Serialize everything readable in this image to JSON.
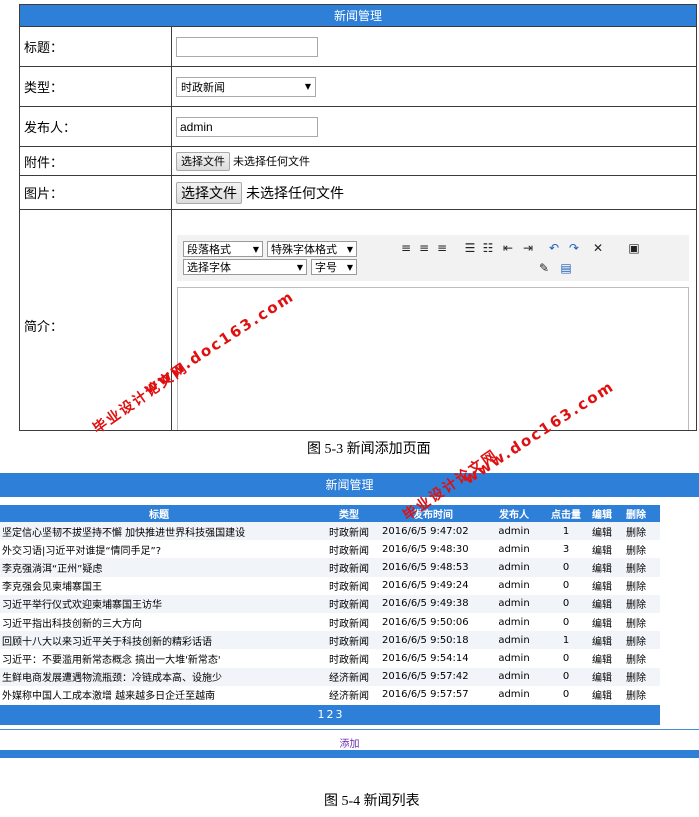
{
  "form": {
    "header": "新闻管理",
    "rows": {
      "title": {
        "label": "标题：",
        "value": ""
      },
      "type": {
        "label": "类型：",
        "selected": "时政新闻"
      },
      "publisher": {
        "label": "发布人：",
        "value": "admin"
      },
      "attachment": {
        "label": "附件：",
        "button": "选择文件",
        "status": "未选择任何文件"
      },
      "image": {
        "label": "图片：",
        "button": "选择文件",
        "status": "未选择任何文件"
      },
      "intro": {
        "label": "简介："
      }
    },
    "editor": {
      "paragraph_format": "段落格式",
      "special_font_format": "特殊字体格式",
      "font_select": "选择字体",
      "font_size": "字号",
      "icons": [
        "align-left-icon",
        "align-center-icon",
        "align-right-icon",
        "bullet-list-icon",
        "numbered-list-icon",
        "outdent-icon",
        "indent-icon",
        "undo-icon",
        "redo-icon",
        "remove-format-icon",
        "paste-icon",
        "highlight-icon",
        "image-icon"
      ]
    }
  },
  "captions": {
    "fig1": "图 5-3 新闻添加页面",
    "fig2": "图 5-4 新闻列表"
  },
  "list": {
    "header": "新闻管理",
    "columns": [
      "标题",
      "类型",
      "发布时间",
      "发布人",
      "点击量",
      "编辑",
      "删除"
    ],
    "rows": [
      [
        "坚定信心坚韧不拔坚持不懈 加快推进世界科技强国建设",
        "时政新闻",
        "2016/6/5 9:47:02",
        "admin",
        "1",
        "编辑",
        "删除"
      ],
      [
        "外交习语|习近平对谁提“情同手足”?",
        "时政新闻",
        "2016/6/5 9:48:30",
        "admin",
        "3",
        "编辑",
        "删除"
      ],
      [
        "李克强淌洱“正州”疑虑",
        "时政新闻",
        "2016/6/5 9:48:53",
        "admin",
        "0",
        "编辑",
        "删除"
      ],
      [
        "李克强会见柬埔寨国王",
        "时政新闻",
        "2016/6/5 9:49:24",
        "admin",
        "0",
        "编辑",
        "删除"
      ],
      [
        "习近平举行仪式欢迎柬埔寨国王访华",
        "时政新闻",
        "2016/6/5 9:49:38",
        "admin",
        "0",
        "编辑",
        "删除"
      ],
      [
        "习近平指出科技创新的三大方向",
        "时政新闻",
        "2016/6/5 9:50:06",
        "admin",
        "0",
        "编辑",
        "删除"
      ],
      [
        "回顾十八大以来习近平关于科技创新的精彩话语",
        "时政新闻",
        "2016/6/5 9:50:18",
        "admin",
        "1",
        "编辑",
        "删除"
      ],
      [
        "习近平：不要滥用新常态概念 搞出一大堆'新常态'",
        "时政新闻",
        "2016/6/5 9:54:14",
        "admin",
        "0",
        "编辑",
        "删除"
      ],
      [
        "生鲜电商发展遭遇物流瓶颈：冷链成本高、设施少",
        "经济新闻",
        "2016/6/5 9:57:42",
        "admin",
        "0",
        "编辑",
        "删除"
      ],
      [
        "外媒称中国人工成本激增 越来越多日企迁至越南",
        "经济新闻",
        "2016/6/5 9:57:57",
        "admin",
        "0",
        "编辑",
        "删除"
      ]
    ],
    "pages": [
      "1",
      "2",
      "3"
    ],
    "add_label": "添加"
  },
  "watermarks": {
    "site": "www.doc163.com",
    "name": "毕业设计论文网"
  },
  "colors": {
    "header_blue": "#2e7fd8",
    "watermark_red": "#e01010",
    "link_purple": "#6a2bb0"
  }
}
